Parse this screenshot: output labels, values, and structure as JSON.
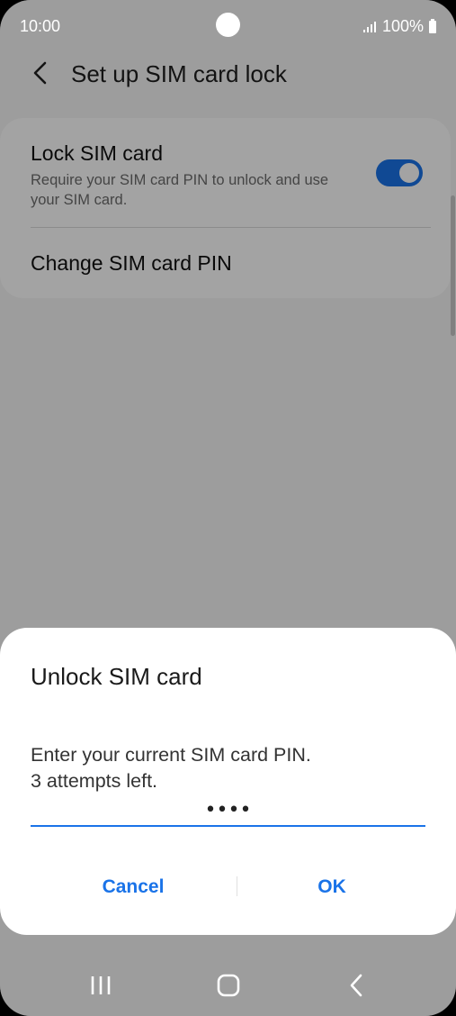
{
  "status_bar": {
    "time": "10:00",
    "battery": "100%"
  },
  "header": {
    "title": "Set up SIM card lock"
  },
  "settings": {
    "lock_sim": {
      "title": "Lock SIM card",
      "description": "Require your SIM card PIN to unlock and use your SIM card.",
      "enabled": true
    },
    "change_pin": {
      "title": "Change SIM card PIN"
    }
  },
  "dialog": {
    "title": "Unlock SIM card",
    "message_line1": "Enter your current SIM card PIN.",
    "message_line2": "3 attempts left.",
    "pin_value": "••••",
    "cancel_label": "Cancel",
    "ok_label": "OK"
  },
  "colors": {
    "accent": "#1a73e8",
    "overlay": "#000000"
  },
  "icons": {
    "back": "chevron-left-icon",
    "signal": "signal-icon",
    "battery": "battery-icon",
    "nav_recents": "recents-icon",
    "nav_home": "home-icon",
    "nav_back": "back-icon"
  }
}
